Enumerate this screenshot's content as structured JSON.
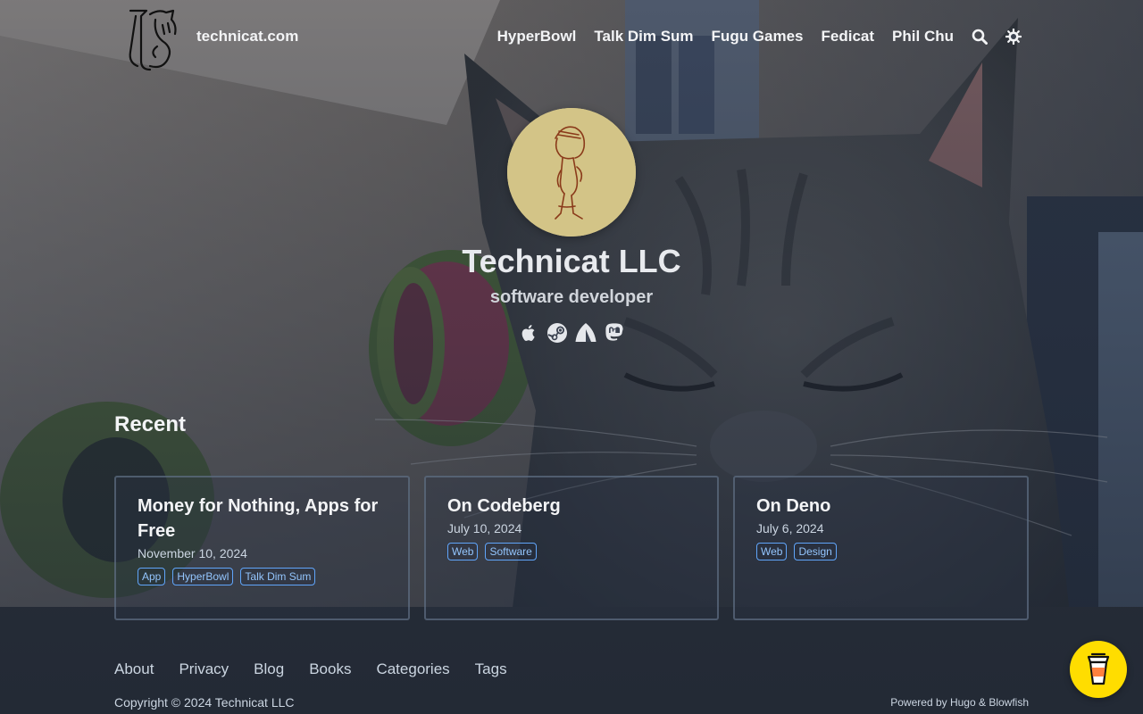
{
  "header": {
    "site_title": "technicat.com",
    "nav": [
      {
        "label": "HyperBowl"
      },
      {
        "label": "Talk Dim Sum"
      },
      {
        "label": "Fugu Games"
      },
      {
        "label": "Fedicat"
      },
      {
        "label": "Phil Chu"
      }
    ],
    "icons": [
      "search-icon",
      "appearance-toggle-icon"
    ]
  },
  "hero": {
    "title": "Technicat LLC",
    "subtitle": "software developer",
    "social_icons": [
      "apple-icon",
      "steam-icon",
      "codeberg-icon",
      "mastodon-icon"
    ]
  },
  "recent": {
    "heading": "Recent",
    "posts": [
      {
        "title": "Money for Nothing, Apps for Free",
        "date": "November 10, 2024",
        "tags": [
          "App",
          "HyperBowl",
          "Talk Dim Sum"
        ]
      },
      {
        "title": "On Codeberg",
        "date": "July 10, 2024",
        "tags": [
          "Web",
          "Software"
        ]
      },
      {
        "title": "On Deno",
        "date": "July 6, 2024",
        "tags": [
          "Web",
          "Design"
        ]
      }
    ]
  },
  "footer": {
    "links": [
      {
        "label": "About"
      },
      {
        "label": "Privacy"
      },
      {
        "label": "Blog"
      },
      {
        "label": "Books"
      },
      {
        "label": "Categories"
      },
      {
        "label": "Tags"
      }
    ],
    "copyright": "Copyright © 2024 Technicat LLC",
    "powered_by": "Powered by Hugo & Blowfish"
  },
  "colors": {
    "tag_text": "#93c5fd",
    "tag_border": "#60a5fa",
    "coffee_button": "#ffdd00"
  }
}
